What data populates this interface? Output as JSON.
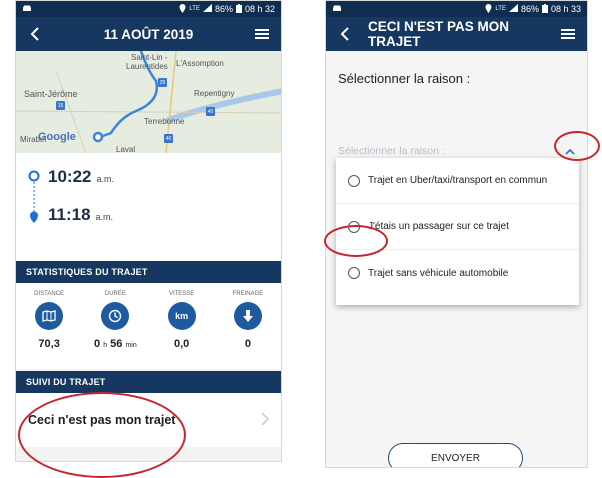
{
  "left_screen": {
    "status": {
      "network": "LTE",
      "battery": "86%",
      "time": "08 h 32"
    },
    "header": {
      "title": "11 AOÛT 2019",
      "back_icon": "back-arrow-icon",
      "menu_icon": "hamburger-menu-icon"
    },
    "map": {
      "labels": [
        "Saint-Lin -",
        "Laurentides",
        "L'Assomption",
        "Saint-Jérôme",
        "Repentigny",
        "Terrebonne",
        "Mirabel",
        "Laval",
        "Google"
      ],
      "route_numbers": [
        "25",
        "15",
        "40",
        "40"
      ]
    },
    "trip": {
      "start_time": "10:22",
      "start_unit": "a.m.",
      "end_time": "11:18",
      "end_unit": "a.m."
    },
    "stats_section": {
      "title": "STATISTIQUES DU TRAJET",
      "items": [
        {
          "label": "DISTANCE",
          "value": "70,3",
          "icon": "map-icon"
        },
        {
          "label": "DURÉE",
          "value_hours": "0",
          "unit_h": "h",
          "value_minutes": "56",
          "unit_min": "min",
          "icon": "clock-icon"
        },
        {
          "label": "VITESSE",
          "value": "0,0",
          "icon": "km-icon",
          "icon_text": "km"
        },
        {
          "label": "FREINAGE",
          "value": "0",
          "icon": "braking-arrow-icon"
        }
      ]
    },
    "follow_section": {
      "title": "SUIVI DU TRAJET",
      "item_label": "Ceci n'est pas mon trajet"
    }
  },
  "right_screen": {
    "status": {
      "network": "LTE",
      "battery": "86%",
      "time": "08 h 33"
    },
    "header": {
      "title": "CECI N'EST PAS MON TRAJET",
      "back_icon": "back-arrow-icon",
      "menu_icon": "hamburger-menu-icon"
    },
    "prompt": "Sélectionner la raison :",
    "select_placeholder": "Sélectionner la raison :",
    "options": [
      "Trajet en Uber/taxi/transport en commun",
      "J'étais un passager sur ce trajet",
      "Trajet sans véhicule automobile"
    ],
    "submit_label": "ENVOYER"
  },
  "colors": {
    "header": "#16375f",
    "statusbar": "#0f2d50",
    "accent": "#1e5a9e",
    "annotation": "#c6262e"
  }
}
